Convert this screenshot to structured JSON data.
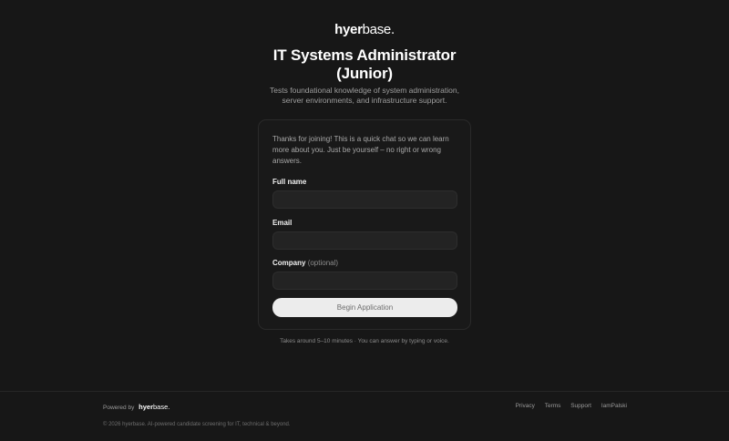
{
  "brand": {
    "bold": "hyer",
    "light": "base."
  },
  "title_line1": "IT Systems Administrator",
  "title_line2": "(Junior)",
  "subtitle_line1": "Tests foundational knowledge of system administration,",
  "subtitle_line2": "server environments, and infrastructure support.",
  "form": {
    "intro": "Thanks for joining! This is a quick chat so we can learn more about you. Just be yourself – no right or wrong answers.",
    "fullname_label": "Full name",
    "fullname_value": "",
    "email_label": "Email",
    "email_value": "",
    "company_label": "Company",
    "company_optional": "(optional)",
    "company_value": "",
    "submit_label": "Begin Application"
  },
  "note": "Takes around 5–10 minutes · You can answer by typing or voice.",
  "footer": {
    "powered_by": "Powered by",
    "links": [
      "Privacy",
      "Terms",
      "Support",
      "IamPalski"
    ],
    "copyright": "© 2026 hyerbase. AI-powered candidate screening for IT, technical & beyond."
  }
}
